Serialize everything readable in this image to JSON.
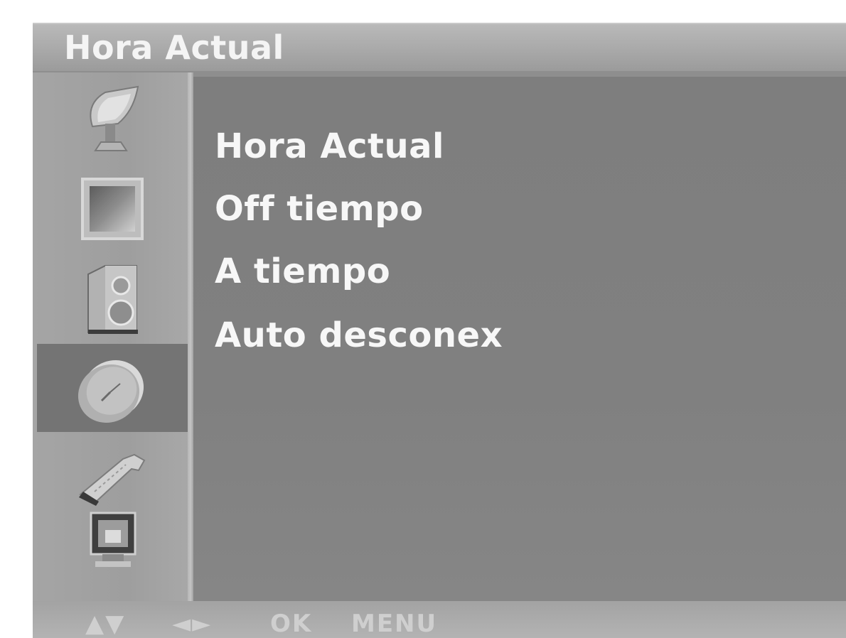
{
  "header": {
    "title": "Hora Actual"
  },
  "sidebar": {
    "items": [
      {
        "icon": "satellite-dish-icon",
        "selected": false
      },
      {
        "icon": "picture-icon",
        "selected": false
      },
      {
        "icon": "speaker-icon",
        "selected": false
      },
      {
        "icon": "clock-icon",
        "selected": true
      },
      {
        "icon": "wrench-icon",
        "selected": false
      },
      {
        "icon": "tv-lock-icon",
        "selected": false
      }
    ]
  },
  "menu": {
    "items": [
      {
        "label": "Hora Actual"
      },
      {
        "label": "Off tiempo"
      },
      {
        "label": "A tiempo"
      },
      {
        "label": "Auto desconex"
      }
    ]
  },
  "footer": {
    "updown_label": "▲▼",
    "leftright_label": "◄►",
    "ok_label": "OK",
    "menu_label": "MENU"
  },
  "colors": {
    "panel": "#8e8e8e",
    "content": "#808080",
    "selected_item": "#747474",
    "text": "#f7f7f7"
  }
}
